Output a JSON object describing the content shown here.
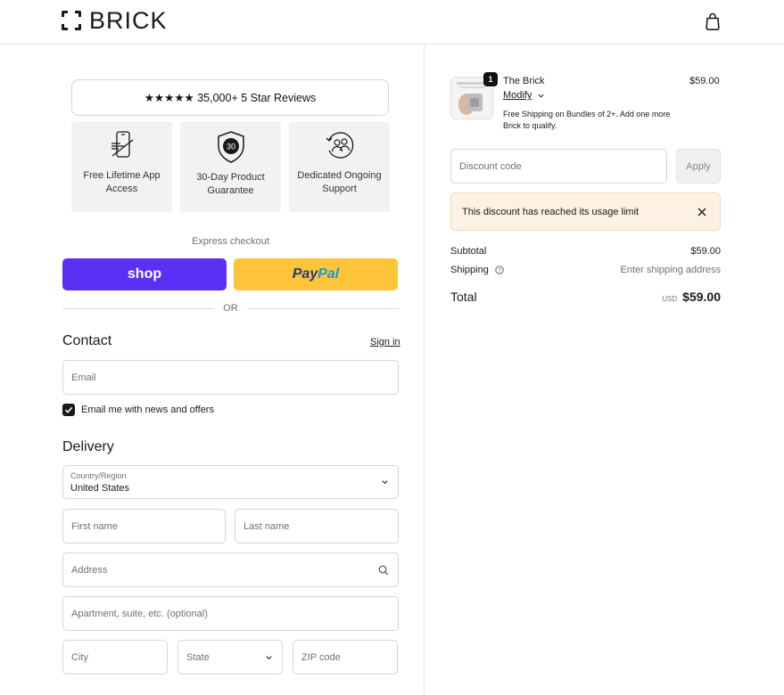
{
  "brand": {
    "name": "BRICK"
  },
  "reviews": {
    "text": "★★★★★ 35,000+ 5 Star Reviews"
  },
  "features": [
    {
      "label": "Free Lifetime App Access",
      "icon": "phone-crossed-icon"
    },
    {
      "label": "30-Day Product Guarantee",
      "icon": "shield-30-icon",
      "badge": "30"
    },
    {
      "label": "Dedicated Ongoing Support",
      "icon": "support-people-icon"
    }
  ],
  "express": {
    "label": "Express checkout",
    "shop_label": "shop",
    "paypal_part1": "Pay",
    "paypal_part2": "Pal",
    "or_label": "OR"
  },
  "contact": {
    "title": "Contact",
    "signin_label": "Sign in",
    "email_placeholder": "Email",
    "newsletter_label": "Email me with news and offers",
    "newsletter_checked": true
  },
  "delivery": {
    "title": "Delivery",
    "country_label": "Country/Region",
    "country_value": "United States",
    "first_name_placeholder": "First name",
    "last_name_placeholder": "Last name",
    "address_placeholder": "Address",
    "apartment_placeholder": "Apartment, suite, etc. (optional)",
    "city_placeholder": "City",
    "state_placeholder": "State",
    "zip_placeholder": "ZIP code"
  },
  "cart": {
    "product_name": "The Brick",
    "quantity": "1",
    "modify_label": "Modify",
    "note": "Free Shipping on Bundles of 2+. Add one more Brick to qualify.",
    "price": "$59.00"
  },
  "discount": {
    "placeholder": "Discount code",
    "apply_label": "Apply",
    "alert_message": "This discount has reached its usage limit"
  },
  "summary": {
    "subtotal_label": "Subtotal",
    "subtotal_value": "$59.00",
    "shipping_label": "Shipping",
    "shipping_value": "Enter shipping address",
    "total_label": "Total",
    "currency": "USD",
    "total_value": "$59.00"
  },
  "colors": {
    "shop_purple": "#5a31f4",
    "paypal_yellow": "#ffc439",
    "alert_bg": "#fdf1e3"
  }
}
